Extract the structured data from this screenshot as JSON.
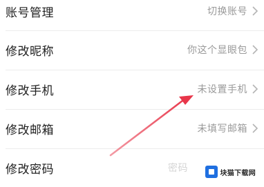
{
  "settings": {
    "rows": [
      {
        "label": "账号管理",
        "value": "切换账号"
      },
      {
        "label": "修改昵称",
        "value": "你这个显眼包"
      },
      {
        "label": "修改手机",
        "value": "未设置手机"
      },
      {
        "label": "修改邮箱",
        "value": "未填写邮箱"
      },
      {
        "label": "修改密码",
        "value": "密码"
      }
    ]
  },
  "annotation": {
    "arrow_color": "#e8364a"
  },
  "watermark": {
    "text": "块猫下载网"
  },
  "colors": {
    "text": "#1f1f1f",
    "secondary": "#9a9a9a",
    "divider": "#ececec"
  }
}
